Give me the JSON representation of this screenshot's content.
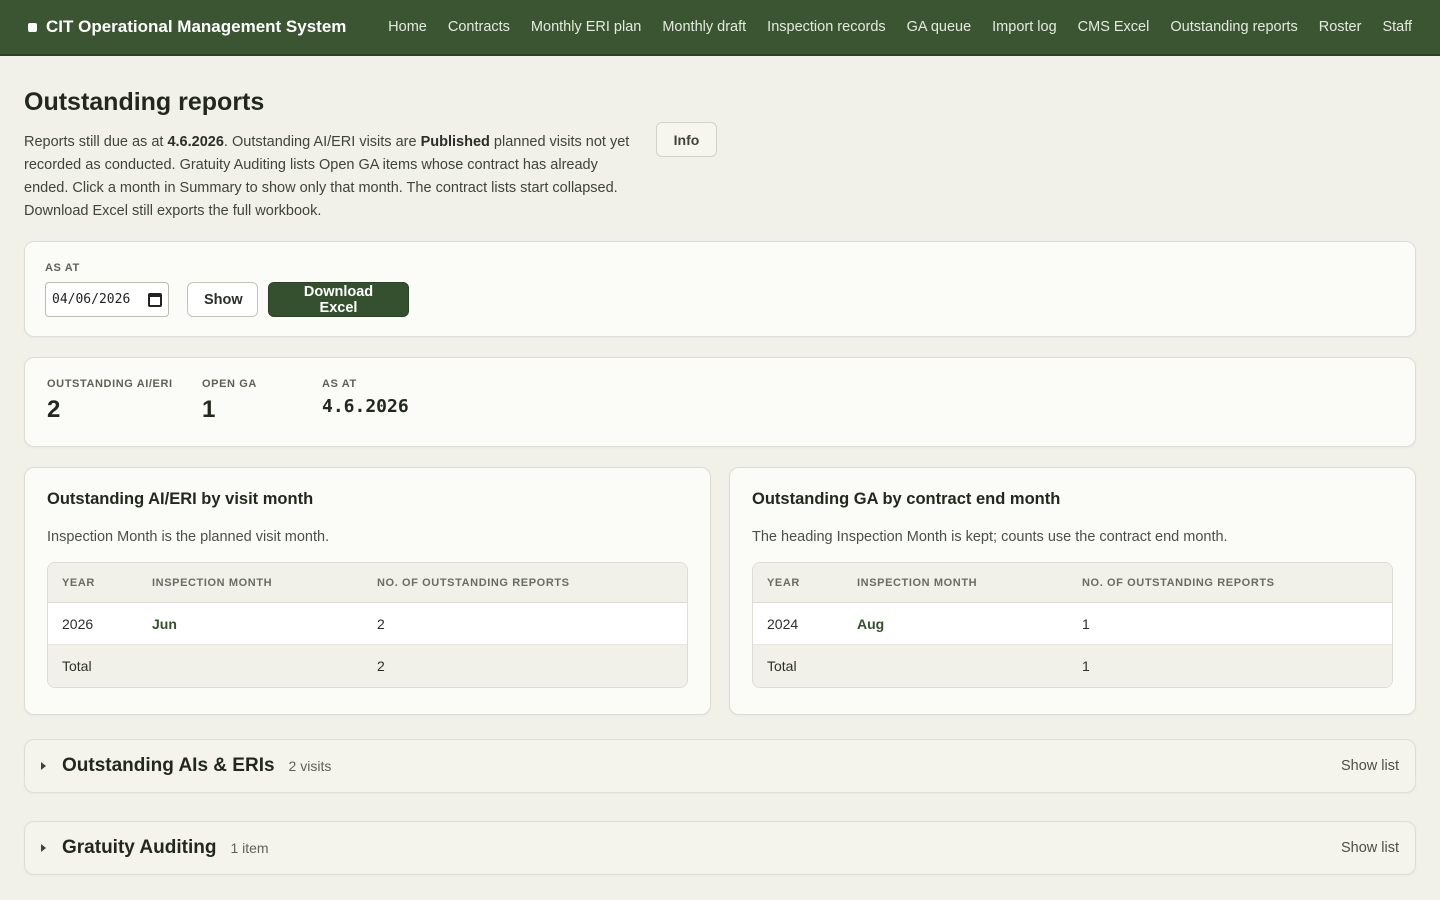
{
  "app": {
    "title": "CIT Operational Management System"
  },
  "nav": [
    "Home",
    "Contracts",
    "Monthly ERI plan",
    "Monthly draft",
    "Inspection records",
    "GA queue",
    "Import log",
    "CMS Excel",
    "Outstanding reports",
    "Roster",
    "Staff"
  ],
  "page": {
    "title": "Outstanding reports",
    "intro_1": "Reports still due as at ",
    "intro_date": "4.6.2026",
    "intro_2": ". Outstanding AI/ERI visits are ",
    "intro_published": "Published",
    "intro_3": " planned visits not yet recorded as conducted. Gratuity Auditing lists Open GA items whose contract has already ended. Click a month in Summary to show only that month. The contract lists start collapsed. Download Excel still exports the full workbook.",
    "info_label": "Info"
  },
  "filter": {
    "label": "AS AT",
    "date_value": "04/06/2026",
    "show_label": "Show",
    "download_label": "Download Excel"
  },
  "stats": [
    {
      "label": "OUTSTANDING AI/ERI",
      "value": "2"
    },
    {
      "label": "OPEN GA",
      "value": "1"
    },
    {
      "label": "AS AT",
      "value": "4.6.2026"
    }
  ],
  "panels": [
    {
      "title": "Outstanding AI/ERI by visit month",
      "subtitle": "Inspection Month is the planned visit month.",
      "headers": [
        "YEAR",
        "INSPECTION MONTH",
        "NO. OF OUTSTANDING REPORTS"
      ],
      "row": {
        "year": "2026",
        "month": "Jun",
        "count": "2"
      },
      "total_label": "Total",
      "total_value": "2"
    },
    {
      "title": "Outstanding GA by contract end month",
      "subtitle": "The heading Inspection Month is kept; counts use the contract end month.",
      "headers": [
        "YEAR",
        "INSPECTION MONTH",
        "NO. OF OUTSTANDING REPORTS"
      ],
      "row": {
        "year": "2024",
        "month": "Aug",
        "count": "1"
      },
      "total_label": "Total",
      "total_value": "1"
    }
  ],
  "sections": [
    {
      "title": "Outstanding AIs & ERIs",
      "count": "2 visits",
      "toggle": "Show list"
    },
    {
      "title": "Gratuity Auditing",
      "count": "1 item",
      "toggle": "Show list"
    }
  ]
}
